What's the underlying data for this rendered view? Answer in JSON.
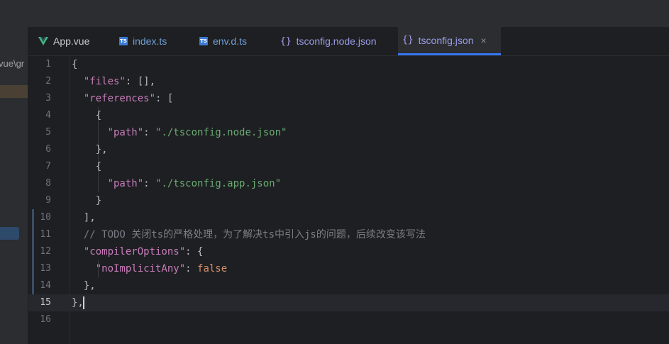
{
  "project": {
    "path_fragment": "vue\\gr"
  },
  "tabs": [
    {
      "label": "App.vue",
      "icon": "vue-icon",
      "type": "vue"
    },
    {
      "label": "index.ts",
      "icon": "ts-file-icon",
      "type": "ts",
      "badge": "TS"
    },
    {
      "label": "env.d.ts",
      "icon": "ts-file-icon",
      "type": "ts",
      "badge": "TS"
    },
    {
      "label": "tsconfig.node.json",
      "icon": "json-icon",
      "type": "json"
    },
    {
      "label": "tsconfig.json",
      "icon": "json-icon",
      "type": "json",
      "active": true,
      "close": "×"
    }
  ],
  "editor": {
    "current_line": 15,
    "lines": [
      {
        "n": "1"
      },
      {
        "n": "2"
      },
      {
        "n": "3"
      },
      {
        "n": "4"
      },
      {
        "n": "5"
      },
      {
        "n": "6"
      },
      {
        "n": "7"
      },
      {
        "n": "8"
      },
      {
        "n": "9"
      },
      {
        "n": "10"
      },
      {
        "n": "11"
      },
      {
        "n": "12"
      },
      {
        "n": "13"
      },
      {
        "n": "14"
      },
      {
        "n": "15"
      },
      {
        "n": "16"
      }
    ],
    "tokens": {
      "open": "{",
      "files_key": "\"files\"",
      "files_val": ": [],",
      "references_key": "\"references\"",
      "references_val": ": [",
      "obj_open": "{",
      "path_key": "\"path\"",
      "colon": ": ",
      "path1": "\"./tsconfig.node.json\"",
      "obj_close_comma": "},",
      "path2": "\"./tsconfig.app.json\"",
      "obj_close": "}",
      "arr_close": "],",
      "comment": "// TODO 关闭ts的严格处理，为了解决ts中引入js的问题，后续改变该写法",
      "compiler_key": "\"compilerOptions\"",
      "compiler_val": ": {",
      "noimplicit_key": "\"noImplicitAny\"",
      "false_val": "false",
      "inner_close": "},",
      "final_close": "},"
    }
  }
}
